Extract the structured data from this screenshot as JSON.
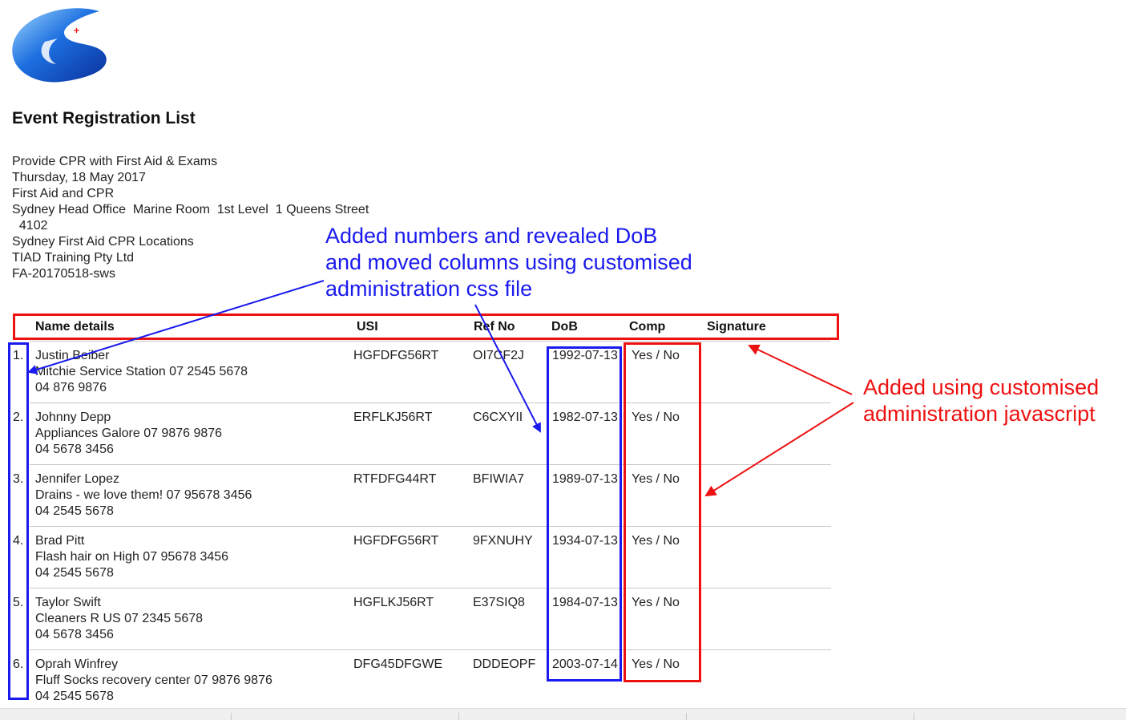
{
  "page": {
    "title": "Event Registration List",
    "info_lines": [
      "Provide CPR with First Aid & Exams",
      "Thursday, 18 May 2017",
      "First Aid and CPR",
      "Sydney Head Office  Marine Room  1st Level  1 Queens Street",
      "  4102",
      "Sydney First Aid CPR Locations",
      "TIAD Training Pty Ltd",
      "FA-20170518-sws"
    ]
  },
  "table": {
    "headers": {
      "name": "Name details",
      "usi": "USI",
      "ref": "Ref No",
      "dob": "DoB",
      "comp": "Comp",
      "signature": "Signature"
    },
    "rows": [
      {
        "num": "1.",
        "name": "Justin Beiber",
        "company": "Mitchie Service Station 07 2545 5678",
        "phone": "04 876 9876",
        "usi": "HGFDFG56RT",
        "ref": "OI7CF2J",
        "dob": "1992-07-13",
        "comp": "Yes / No"
      },
      {
        "num": "2.",
        "name": "Johnny Depp",
        "company": "Appliances Galore 07 9876 9876",
        "phone": "04 5678 3456",
        "usi": "ERFLKJ56RT",
        "ref": "C6CXYII",
        "dob": "1982-07-13",
        "comp": "Yes / No"
      },
      {
        "num": "3.",
        "name": "Jennifer Lopez",
        "company": "Drains - we love them! 07 95678 3456",
        "phone": "04 2545 5678",
        "usi": "RTFDFG44RT",
        "ref": "BFIWIA7",
        "dob": "1989-07-13",
        "comp": "Yes / No"
      },
      {
        "num": "4.",
        "name": "Brad Pitt",
        "company": "Flash hair on High 07 95678 3456",
        "phone": "04 2545 5678",
        "usi": "HGFDFG56RT",
        "ref": "9FXNUHY",
        "dob": "1934-07-13",
        "comp": "Yes / No"
      },
      {
        "num": "5.",
        "name": "Taylor Swift",
        "company": "Cleaners R US 07 2345 5678",
        "phone": "04 5678 3456",
        "usi": "HGFLKJ56RT",
        "ref": "E37SIQ8",
        "dob": "1984-07-13",
        "comp": "Yes / No"
      },
      {
        "num": "6.",
        "name": "Oprah Winfrey",
        "company": "Fluff Socks recovery center 07 9876 9876",
        "phone": "04 2545 5678",
        "usi": "DFG45DFGWE",
        "ref": "DDDEOPF",
        "dob": "2003-07-14",
        "comp": "Yes / No"
      }
    ]
  },
  "annotations": {
    "blue_lines": [
      "Added numbers and revealed DoB",
      "and moved columns using customised",
      "administration css file"
    ],
    "red_lines": [
      "Added using customised",
      "administration javascript"
    ]
  },
  "colors": {
    "annotation_blue": "#1a1aee",
    "annotation_red": "#ee1111",
    "logo_blue": "#1560d8"
  }
}
